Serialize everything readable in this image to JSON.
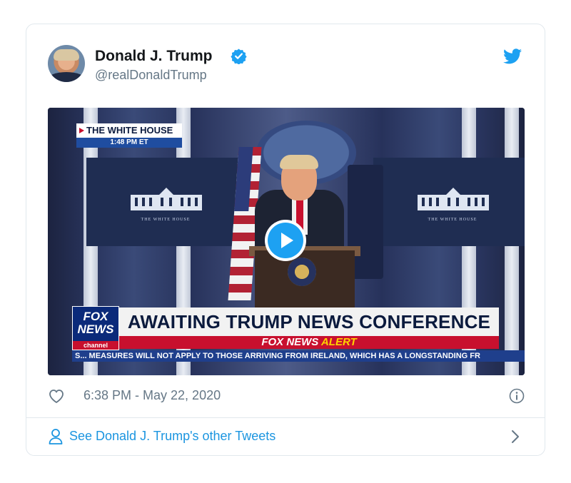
{
  "tweet": {
    "author_name": "Donald J. Trump",
    "handle": "@realDonaldTrump",
    "timestamp": "6:38 PM - May 22, 2020"
  },
  "video": {
    "bug_title": "THE WHITE HOUSE",
    "bug_time": "1:48 PM ET",
    "panel_caption": "THE WHITE HOUSE",
    "logo_line1": "FOX",
    "logo_line2": "NEWS",
    "logo_line3": "channel",
    "headline": "AWAITING TRUMP NEWS CONFERENCE",
    "alert_prefix": "FOX NEWS",
    "alert_word": "ALERT",
    "ticker": "S... MEASURES WILL NOT APPLY TO THOSE ARRIVING FROM IRELAND, WHICH HAS A LONGSTANDING FR"
  },
  "footer": {
    "link_text": "See Donald J. Trump's other Tweets"
  },
  "icons": {
    "verified": "verified-badge-icon",
    "twitter": "twitter-bird-icon",
    "like": "heart-icon",
    "info": "info-icon",
    "profile": "person-icon",
    "chevron": "chevron-right-icon",
    "play": "play-icon"
  },
  "colors": {
    "accent": "#1da1f2",
    "link": "#1b95e0",
    "muted": "#657786",
    "fox_red": "#c8102e",
    "fox_blue": "#0b2a7a"
  }
}
